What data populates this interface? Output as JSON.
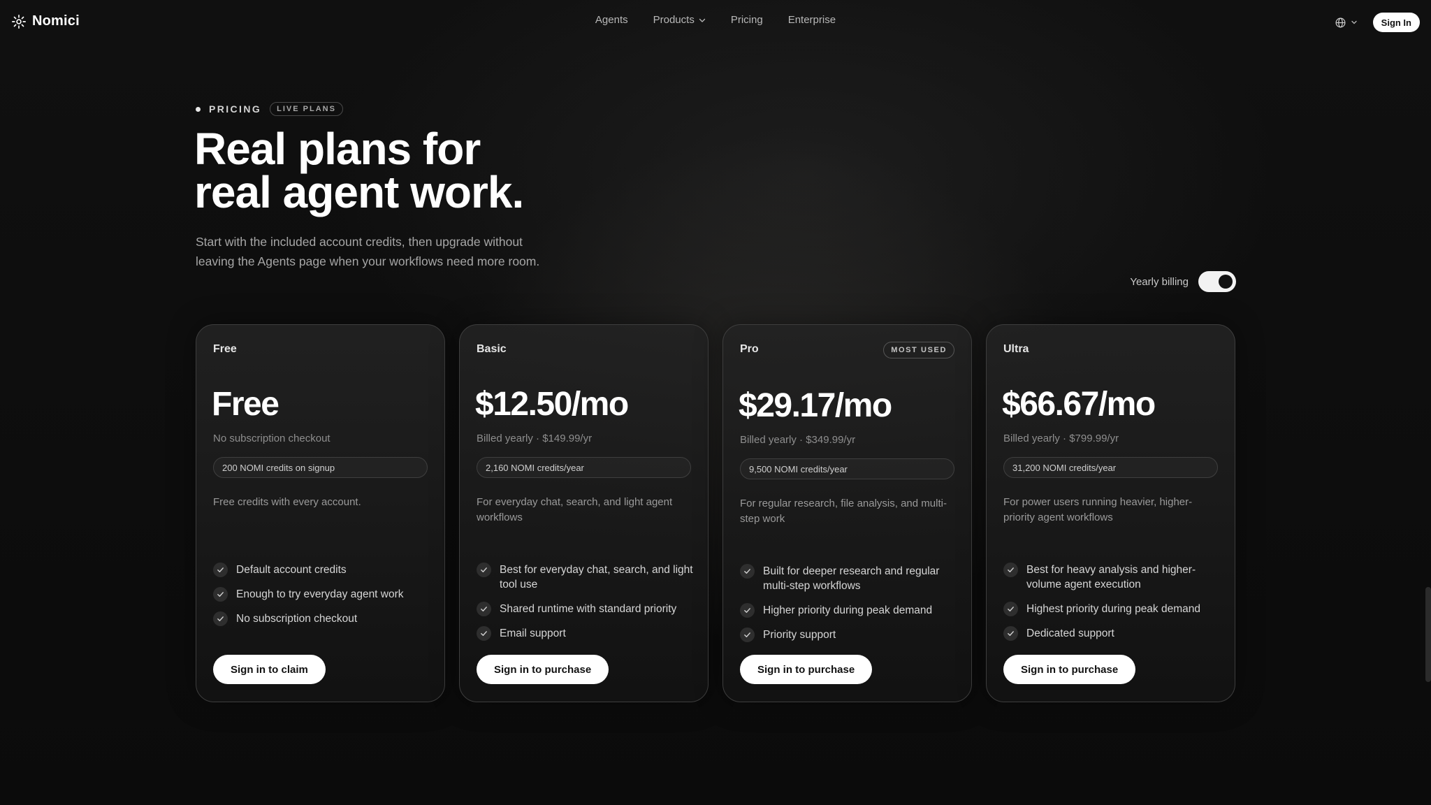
{
  "header": {
    "brand": "Nomici",
    "nav": [
      {
        "label": "Agents"
      },
      {
        "label": "Products"
      },
      {
        "label": "Pricing"
      },
      {
        "label": "Enterprise"
      }
    ],
    "sign_in": "Sign In"
  },
  "hero": {
    "eyebrow": "PRICING",
    "badge": "LIVE PLANS",
    "title_line1": "Real plans for",
    "title_line2": "real agent work.",
    "subtitle": "Start with the included account credits, then upgrade without leaving the Agents page when your workflows need more room."
  },
  "billing": {
    "label": "Yearly billing",
    "enabled": true
  },
  "plans": [
    {
      "name": "Free",
      "price": "Free",
      "billed": "No subscription checkout",
      "credits": "200 NOMI credits on signup",
      "description": "Free credits with every account.",
      "features": [
        "Default account credits",
        "Enough to try everyday agent work",
        "No subscription checkout"
      ],
      "cta": "Sign in to claim"
    },
    {
      "name": "Basic",
      "price": "$12.50/mo",
      "billed": "Billed yearly · $149.99/yr",
      "credits": "2,160 NOMI credits/year",
      "description": "For everyday chat, search, and light agent workflows",
      "features": [
        "Best for everyday chat, search, and light tool use",
        "Shared runtime with standard priority",
        "Email support"
      ],
      "cta": "Sign in to purchase"
    },
    {
      "name": "Pro",
      "badge": "MOST USED",
      "price": "$29.17/mo",
      "billed": "Billed yearly · $349.99/yr",
      "credits": "9,500 NOMI credits/year",
      "description": "For regular research, file analysis, and multi-step work",
      "features": [
        "Built for deeper research and regular multi-step workflows",
        "Higher priority during peak demand",
        "Priority support"
      ],
      "cta": "Sign in to purchase"
    },
    {
      "name": "Ultra",
      "price": "$66.67/mo",
      "billed": "Billed yearly · $799.99/yr",
      "credits": "31,200 NOMI credits/year",
      "description": "For power users running heavier, higher-priority agent workflows",
      "features": [
        "Best for heavy analysis and higher-volume agent execution",
        "Highest priority during peak demand",
        "Dedicated support"
      ],
      "cta": "Sign in to purchase"
    }
  ],
  "colors": {
    "background": "#0d0d0d",
    "card_border": "#3e3e3e",
    "button_bg": "#ffffff",
    "button_text": "#111111",
    "muted_text": "#9a9a9a"
  },
  "icons": {
    "logo": "nomici-logo-icon",
    "products_chevron": "chevron-down-icon",
    "language": "globe-icon",
    "feature_check": "check-icon"
  }
}
